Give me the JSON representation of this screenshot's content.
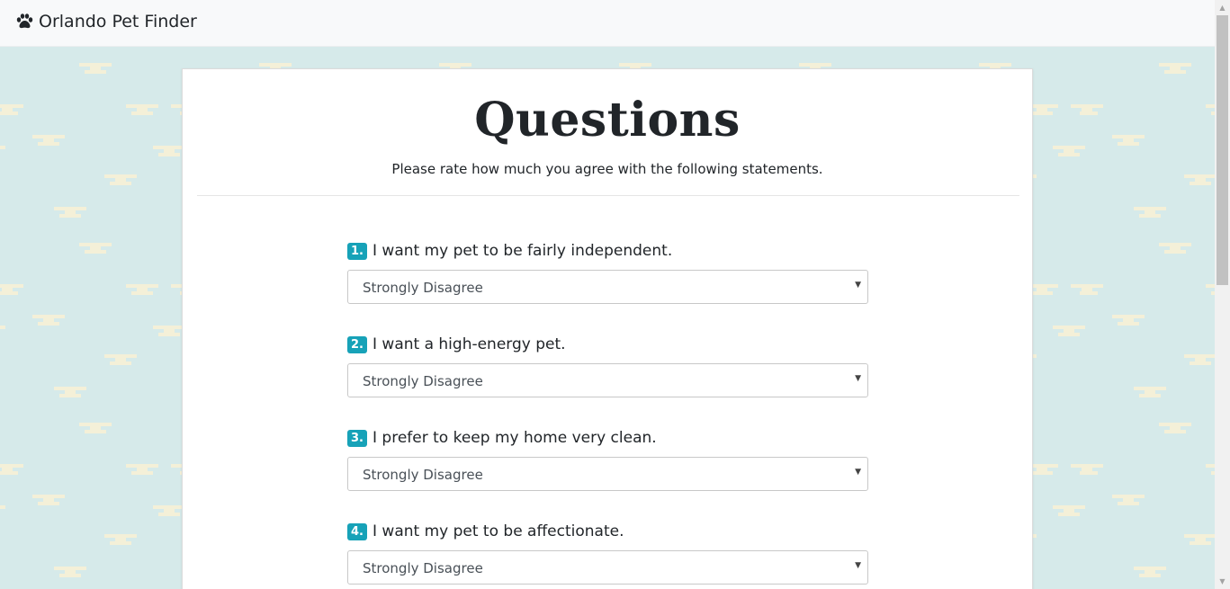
{
  "navbar": {
    "brand": "Orlando Pet Finder"
  },
  "card": {
    "title": "Questions",
    "subtitle": "Please rate how much you agree with the following statements."
  },
  "questions": [
    {
      "number": "1.",
      "text": "I want my pet to be fairly independent.",
      "selected": "Strongly Disagree"
    },
    {
      "number": "2.",
      "text": "I want a high-energy pet.",
      "selected": "Strongly Disagree"
    },
    {
      "number": "3.",
      "text": "I prefer to keep my home very clean.",
      "selected": "Strongly Disagree"
    },
    {
      "number": "4.",
      "text": "I want my pet to be affectionate.",
      "selected": "Strongly Disagree"
    }
  ],
  "colors": {
    "background": "#d6eaea",
    "pattern": "#f4f0d8",
    "badge": "#17a2b8",
    "navbar": "#f8f9fa"
  },
  "icons": {
    "brand_icon": "paw-icon",
    "select_icon": "caret-down-icon"
  }
}
